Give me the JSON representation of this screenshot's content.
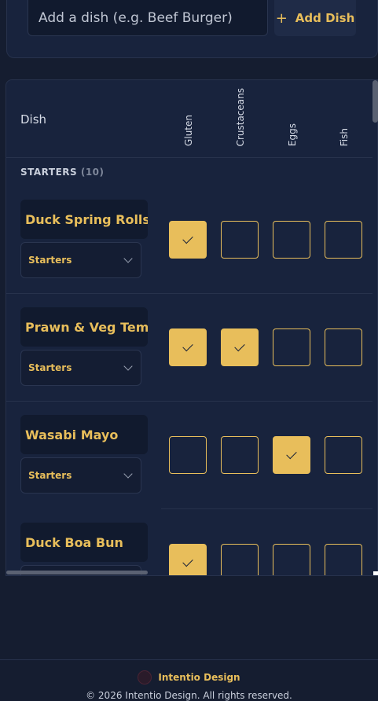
{
  "add_form": {
    "placeholder": "Add a dish (e.g. Beef Burger)",
    "button_label": "Add Dish"
  },
  "table": {
    "dish_header": "Dish",
    "columns": [
      "Gluten",
      "Crustaceans",
      "Eggs",
      "Fish"
    ],
    "section": {
      "title": "STARTERS",
      "count": "(10)"
    },
    "rows": [
      {
        "name": "Duck Spring Rolls",
        "category": "Starters",
        "checks": [
          true,
          false,
          false,
          false
        ]
      },
      {
        "name": "Prawn & Veg Temp",
        "category": "Starters",
        "checks": [
          true,
          true,
          false,
          false
        ]
      },
      {
        "name": "Wasabi Mayo",
        "category": "Starters",
        "checks": [
          false,
          false,
          true,
          false
        ]
      },
      {
        "name": "Duck Boa Bun",
        "category": "Starters",
        "checks": [
          true,
          false,
          false,
          false
        ]
      }
    ]
  },
  "footer": {
    "brand": "Intentio Design",
    "copyright": "© 2026 Intentio Design. All rights reserved."
  },
  "colors": {
    "accent": "#e8be5b",
    "background": "#151d30",
    "card": "#18233d"
  }
}
